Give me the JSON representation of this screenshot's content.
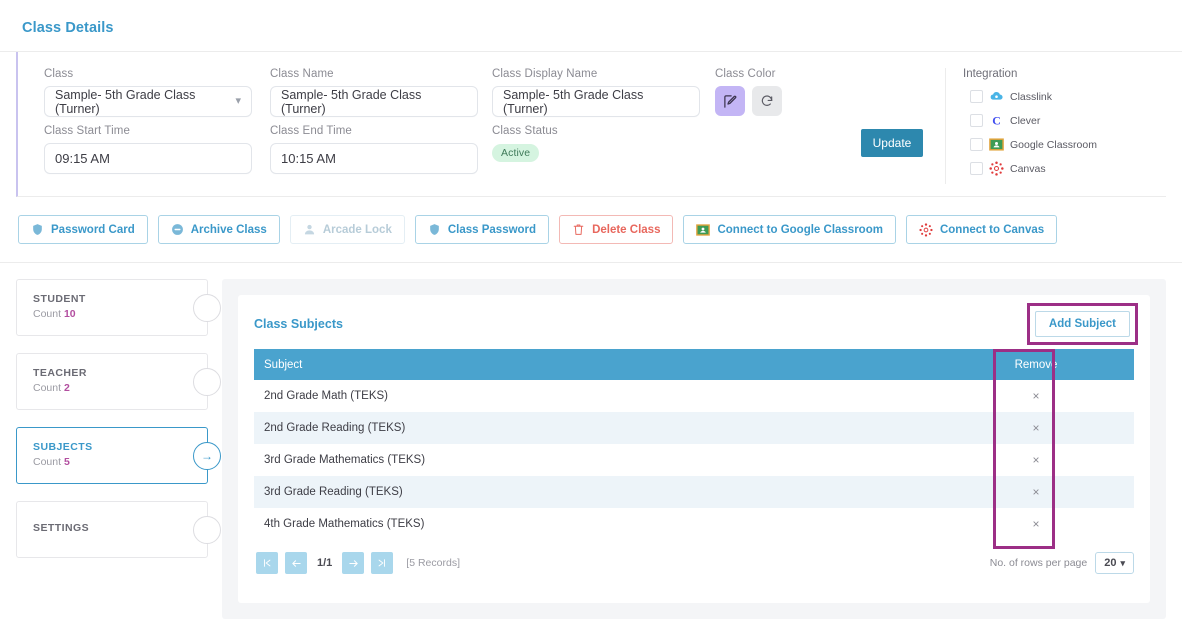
{
  "page": {
    "title": "Class Details"
  },
  "form": {
    "fields": {
      "class": {
        "label": "Class",
        "value": "Sample- 5th Grade Class (Turner)"
      },
      "class_name": {
        "label": "Class Name",
        "value": "Sample- 5th Grade Class (Turner)"
      },
      "class_display_name": {
        "label": "Class Display Name",
        "value": "Sample- 5th Grade Class (Turner)"
      },
      "class_color": {
        "label": "Class Color"
      },
      "class_start_time": {
        "label": "Class Start Time",
        "value": "09:15 AM"
      },
      "class_end_time": {
        "label": "Class End Time",
        "value": "10:15 AM"
      },
      "class_status": {
        "label": "Class Status",
        "value": "Active"
      }
    },
    "update_label": "Update"
  },
  "integration": {
    "title": "Integration",
    "items": [
      {
        "label": "Classlink",
        "icon": "classlink-icon",
        "checked": false
      },
      {
        "label": "Clever",
        "icon": "clever-icon",
        "checked": false
      },
      {
        "label": "Google Classroom",
        "icon": "google-classroom-icon",
        "checked": false
      },
      {
        "label": "Canvas",
        "icon": "canvas-icon",
        "checked": false
      }
    ]
  },
  "actions": [
    {
      "label": "Password Card",
      "icon": "shield-icon",
      "style": "normal"
    },
    {
      "label": "Archive Class",
      "icon": "minus-circle-icon",
      "style": "normal"
    },
    {
      "label": "Arcade Lock",
      "icon": "person-icon",
      "style": "muted"
    },
    {
      "label": "Class Password",
      "icon": "shield-icon",
      "style": "normal"
    },
    {
      "label": "Delete Class",
      "icon": "trash-icon",
      "style": "danger"
    },
    {
      "label": "Connect to Google Classroom",
      "icon": "google-classroom-icon",
      "style": "normal"
    },
    {
      "label": "Connect to Canvas",
      "icon": "canvas-icon",
      "style": "normal"
    }
  ],
  "sidebar": {
    "items": [
      {
        "name": "STUDENT",
        "count_label": "Count",
        "count": "10",
        "active": false
      },
      {
        "name": "TEACHER",
        "count_label": "Count",
        "count": "2",
        "active": false
      },
      {
        "name": "SUBJECTS",
        "count_label": "Count",
        "count": "5",
        "active": true
      },
      {
        "name": "SETTINGS",
        "count_label": "",
        "count": "",
        "active": false
      }
    ]
  },
  "subjects_panel": {
    "title": "Class Subjects",
    "add_button": "Add Subject",
    "columns": [
      "Subject",
      "Remove"
    ],
    "rows": [
      {
        "subject": "2nd Grade Math (TEKS)",
        "remove": "×"
      },
      {
        "subject": "2nd Grade Reading (TEKS)",
        "remove": "×"
      },
      {
        "subject": "3rd Grade Mathematics (TEKS)",
        "remove": "×"
      },
      {
        "subject": "3rd Grade Reading (TEKS)",
        "remove": "×"
      },
      {
        "subject": "4th Grade Mathematics (TEKS)",
        "remove": "×"
      }
    ],
    "pagination": {
      "first": "⏮",
      "prev": "←",
      "page_indicator": "1/1",
      "next": "→",
      "last": "⏭",
      "records": "[5 Records]",
      "rows_label": "No. of rows per page",
      "rows_value": "20"
    }
  },
  "colors": {
    "accent_blue": "#3a98c9",
    "table_header": "#4aa3ce",
    "highlight_purple": "#9c2f86",
    "count_magenta": "#b34fa0",
    "status_green_bg": "#d5f4e0",
    "danger_red": "#e8675d",
    "class_color_swatch": "#c3b5f5"
  }
}
